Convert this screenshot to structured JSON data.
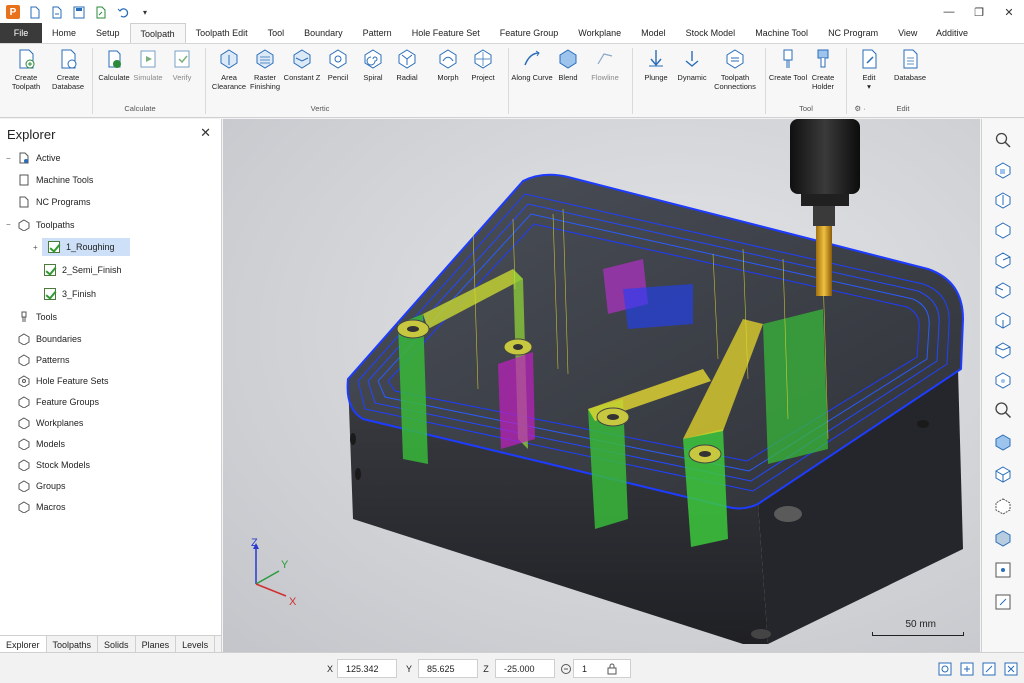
{
  "app": {
    "logo_letter": "P",
    "window_controls": [
      "—",
      "❐",
      "✕"
    ]
  },
  "menu": {
    "tabs": [
      "File",
      "Home",
      "Setup",
      "Toolpath",
      "Toolpath Edit",
      "Tool",
      "Boundary",
      "Pattern",
      "Hole Feature Set",
      "Feature Group",
      "Workplane",
      "Model",
      "Stock Model",
      "Machine Tool",
      "NC Program",
      "View"
    ],
    "active": "Toolpath",
    "additive": "Additive"
  },
  "ribbon": {
    "create_toolpath": "Create Toolpath",
    "create_database": "Create Database",
    "calculate": "Calculate",
    "simulate": "Simulate",
    "verify": "Verify",
    "group_calculate": "Calculate",
    "area_clearance": "Area Clearance",
    "raster_finishing": "Raster Finishing",
    "constant_z": "Constant Z",
    "pencil": "Pencil",
    "spiral": "Spiral",
    "radial": "Radial",
    "morph": "Morph",
    "project": "Project",
    "group_vertical": "Vertic",
    "along_curve": "Along Curve",
    "blend": "Blend",
    "flowline": "Flowline",
    "plunge": "Plunge",
    "dynamic": "Dynamic",
    "toolpath_connections": "Toolpath Connections",
    "create_tool": "Create Tool",
    "create_holder": "Create Holder",
    "group_tool": "Tool",
    "edit": "Edit",
    "edit_arrow": "▾",
    "database": "Database",
    "group_edit": "Edit",
    "group_misc": "⚙ ·"
  },
  "explorer": {
    "title": "Explorer",
    "close": "✕",
    "items": {
      "active": "Active",
      "machine_tools": "Machine Tools",
      "nc_programs": "NC Programs",
      "toolpaths": "Toolpaths",
      "tp1": "1_Roughing",
      "tp2": "2_Semi_Finish",
      "tp3": "3_Finish",
      "tools": "Tools",
      "boundaries": "Boundaries",
      "patterns": "Patterns",
      "hole_feature_sets": "Hole Feature Sets",
      "feature_groups": "Feature Groups",
      "workplanes": "Workplanes",
      "models": "Models",
      "stock_models": "Stock Models",
      "groups": "Groups",
      "macros": "Macros"
    },
    "bottom_tabs": [
      "Explorer",
      "Toolpaths",
      "Solids",
      "Planes",
      "Levels"
    ]
  },
  "viewport": {
    "axis_z": "Z",
    "axis_y": "Y",
    "axis_x": "X",
    "scale": "50 mm"
  },
  "status": {
    "x_label": "X",
    "x_value": "125.342",
    "y_label": "Y",
    "y_value": "85.625",
    "z_label": "Z",
    "z_value": "-25.000",
    "count_value": "1"
  },
  "colors": {
    "accent": "#e8711c",
    "toolpath_blue": "#1f3cff",
    "toolpath_green": "#3cc83c",
    "toolpath_yellow": "#f0e020",
    "toolpath_magenta": "#c020c0"
  }
}
